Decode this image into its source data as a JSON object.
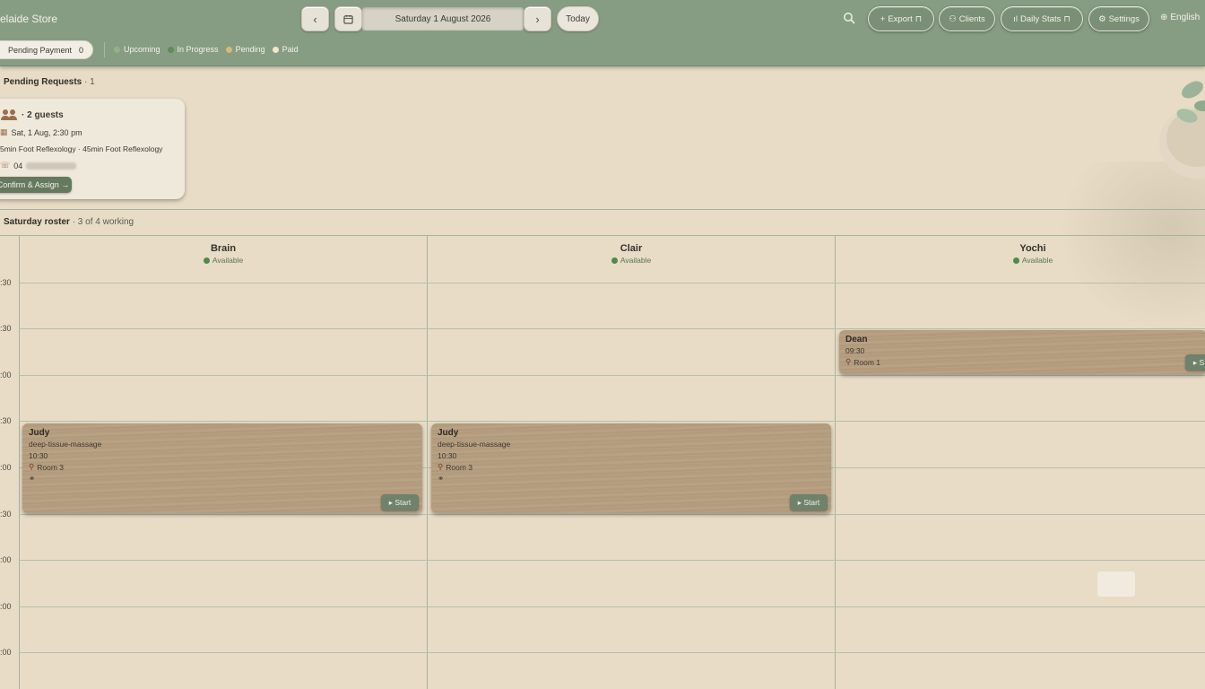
{
  "header": {
    "store_title": "elaide Store",
    "prev_glyph": "‹",
    "next_glyph": "›",
    "date": "Saturday 1 August 2026",
    "today_label": "Today",
    "export_label": "Export",
    "clients_label": "Clients",
    "daily_stats_label": "Daily Stats",
    "settings_label": "Settings",
    "language": "English",
    "pending_payment_label": "Pending Payment",
    "pending_payment_count": "0",
    "legend": [
      {
        "label": "Upcoming",
        "color": "#8fb287"
      },
      {
        "label": "In Progress",
        "color": "#5f8b57"
      },
      {
        "label": "Pending",
        "color": "#d9b87a"
      },
      {
        "label": "Paid",
        "color": "#f1e8c8"
      }
    ]
  },
  "pending": {
    "title": "Pending Requests",
    "count": "· 1",
    "card": {
      "guests": "· 2 guests",
      "datetime": "Sat, 1 Aug, 2:30 pm",
      "services": "5min Foot Reflexology · 45min Foot Reflexology",
      "phone_prefix": "04",
      "confirm_label": "Confirm & Assign →"
    }
  },
  "roster": {
    "title": "Saturday roster",
    "subtitle": "· 3 of 4 working",
    "times": [
      ":30",
      ":30",
      ":00",
      ":30",
      ":00",
      ":30",
      ":00",
      ":00",
      ":00"
    ],
    "therapists": [
      {
        "name": "Brain",
        "status": "Available"
      },
      {
        "name": "Clair",
        "status": "Available"
      },
      {
        "name": "Yochi",
        "status": "Available"
      }
    ],
    "appointments": [
      {
        "client": "Judy",
        "service": "deep-tissue-massage",
        "time": "10:30",
        "room": "Room 3",
        "start": "▸ Start"
      },
      {
        "client": "Judy",
        "service": "deep-tissue-massage",
        "time": "10:30",
        "room": "Room 3",
        "start": "▸ Start"
      },
      {
        "client": "Dean",
        "time": "09:30",
        "room": "Room 1",
        "start": "▸ S"
      }
    ]
  },
  "colors": {
    "header_bg": "#879d83",
    "page_bg": "#e8dcc6",
    "accent_green": "#65795f",
    "card_wood": "#b59d80"
  }
}
